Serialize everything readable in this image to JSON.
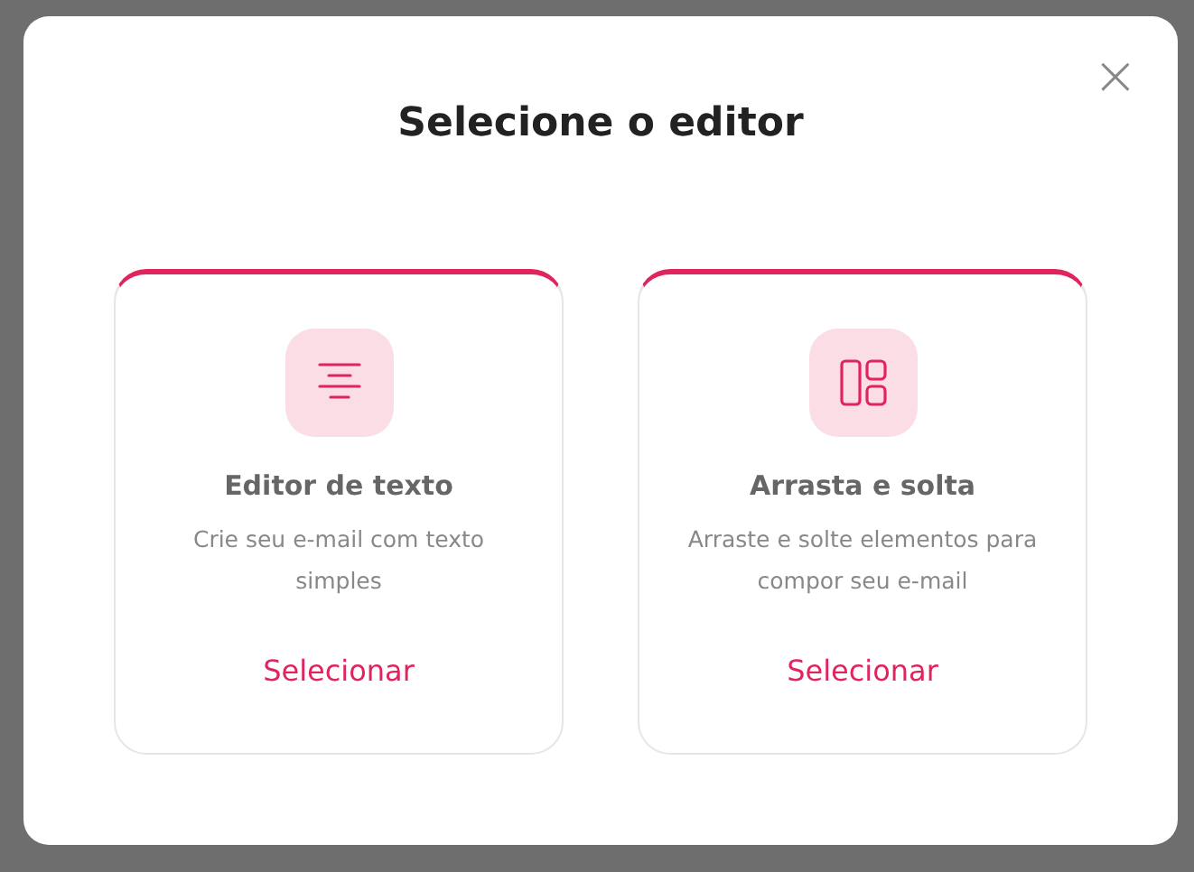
{
  "dialog": {
    "title": "Selecione o editor",
    "close": "×"
  },
  "options": [
    {
      "kind": "text",
      "title": "Editor de texto",
      "description": "Crie seu e-mail com texto simples",
      "action": "Selecionar"
    },
    {
      "kind": "layout",
      "title": "Arrasta e solta",
      "description": "Arraste e solte elementos para compor seu e-mail",
      "action": "Selecionar"
    }
  ]
}
